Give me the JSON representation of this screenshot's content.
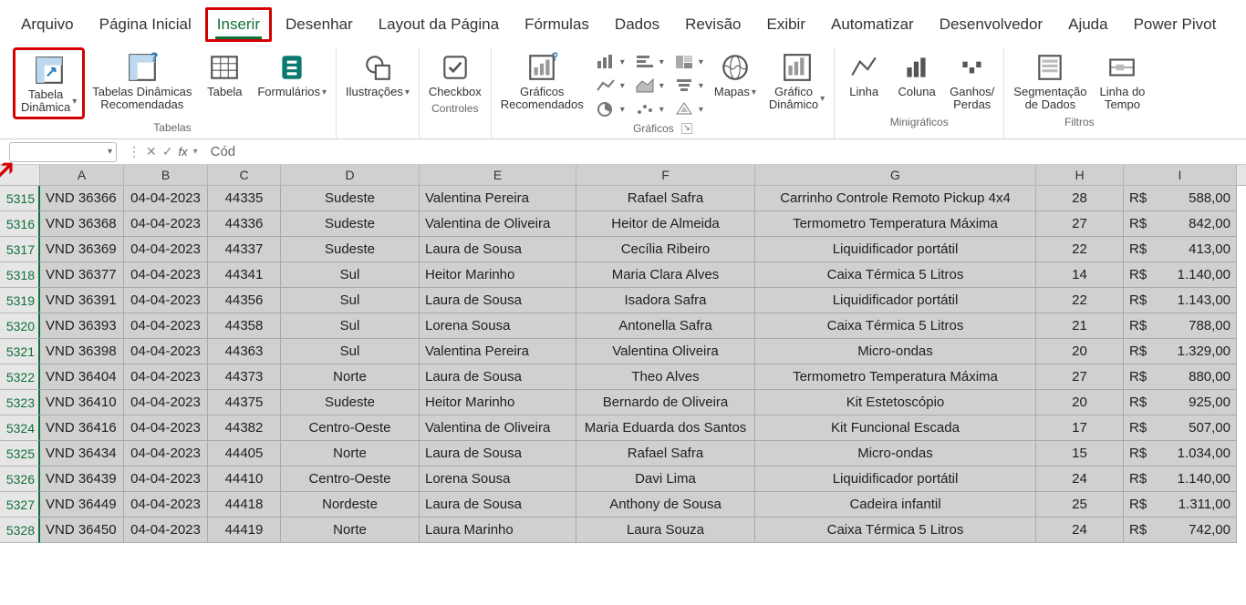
{
  "menu": {
    "tabs": [
      "Arquivo",
      "Página Inicial",
      "Inserir",
      "Desenhar",
      "Layout da Página",
      "Fórmulas",
      "Dados",
      "Revisão",
      "Exibir",
      "Automatizar",
      "Desenvolvedor",
      "Ajuda",
      "Power Pivot"
    ],
    "active_index": 2
  },
  "ribbon": {
    "groups": [
      {
        "name": "Tabelas",
        "items": [
          {
            "label": "Tabela\nDinâmica",
            "caret": true,
            "icon": "pivot-table",
            "highlighted": true
          },
          {
            "label": "Tabelas Dinâmicas\nRecomendadas",
            "icon": "pivot-recommended"
          },
          {
            "label": "Tabela",
            "icon": "table"
          },
          {
            "label": "Formulários",
            "caret": true,
            "icon": "forms"
          }
        ]
      },
      {
        "name": "",
        "items": [
          {
            "label": "Ilustrações",
            "caret": true,
            "icon": "shapes"
          }
        ]
      },
      {
        "name": "Controles",
        "items": [
          {
            "label": "Checkbox",
            "icon": "checkbox"
          }
        ]
      },
      {
        "name": "Gráficos",
        "launcher": true,
        "items": [
          {
            "label": "Gráficos\nRecomendados",
            "icon": "chart-recommended"
          },
          {
            "stack": true,
            "minis": [
              {
                "icon": "chart-bar"
              },
              {
                "icon": "chart-line"
              },
              {
                "icon": "chart-pie"
              }
            ]
          },
          {
            "stack": true,
            "minis": [
              {
                "icon": "chart-hbar"
              },
              {
                "icon": "chart-area"
              },
              {
                "icon": "chart-scatter"
              }
            ]
          },
          {
            "stack": true,
            "minis": [
              {
                "icon": "chart-tree"
              },
              {
                "icon": "chart-funnel"
              },
              {
                "icon": "chart-radar"
              }
            ]
          },
          {
            "label": "Mapas",
            "caret": true,
            "icon": "map"
          },
          {
            "label": "Gráfico\nDinâmico",
            "caret": true,
            "icon": "pivot-chart"
          }
        ]
      },
      {
        "name": "Minigráficos",
        "items": [
          {
            "label": "Linha",
            "icon": "spark-line"
          },
          {
            "label": "Coluna",
            "icon": "spark-col"
          },
          {
            "label": "Ganhos/\nPerdas",
            "icon": "spark-winloss"
          }
        ]
      },
      {
        "name": "Filtros",
        "items": [
          {
            "label": "Segmentação\nde Dados",
            "icon": "slicer"
          },
          {
            "label": "Linha do\nTempo",
            "icon": "timeline"
          }
        ]
      }
    ]
  },
  "formula_bar": {
    "name_box": "",
    "value": "Cód"
  },
  "columns": [
    "A",
    "B",
    "C",
    "D",
    "E",
    "F",
    "G",
    "H",
    "I"
  ],
  "row_start": 5315,
  "rows": [
    {
      "r": 5315,
      "A": "VND 36366",
      "B": "04-04-2023",
      "C": "44335",
      "D": "Sudeste",
      "E": "Valentina Pereira",
      "F": "Rafael Safra",
      "G": "Carrinho Controle Remoto Pickup 4x4",
      "H": "28",
      "I_cur": "R$",
      "I_val": "588,00"
    },
    {
      "r": 5316,
      "A": "VND 36368",
      "B": "04-04-2023",
      "C": "44336",
      "D": "Sudeste",
      "E": "Valentina de Oliveira",
      "F": "Heitor de Almeida",
      "G": "Termometro Temperatura Máxima",
      "H": "27",
      "I_cur": "R$",
      "I_val": "842,00"
    },
    {
      "r": 5317,
      "A": "VND 36369",
      "B": "04-04-2023",
      "C": "44337",
      "D": "Sudeste",
      "E": "Laura de Sousa",
      "F": "Cecília Ribeiro",
      "G": "Liquidificador portátil",
      "H": "22",
      "I_cur": "R$",
      "I_val": "413,00"
    },
    {
      "r": 5318,
      "A": "VND 36377",
      "B": "04-04-2023",
      "C": "44341",
      "D": "Sul",
      "E": "Heitor Marinho",
      "F": "Maria Clara Alves",
      "G": "Caixa Térmica 5 Litros",
      "H": "14",
      "I_cur": "R$",
      "I_val": "1.140,00"
    },
    {
      "r": 5319,
      "A": "VND 36391",
      "B": "04-04-2023",
      "C": "44356",
      "D": "Sul",
      "E": "Laura de Sousa",
      "F": "Isadora Safra",
      "G": "Liquidificador portátil",
      "H": "22",
      "I_cur": "R$",
      "I_val": "1.143,00"
    },
    {
      "r": 5320,
      "A": "VND 36393",
      "B": "04-04-2023",
      "C": "44358",
      "D": "Sul",
      "E": "Lorena Sousa",
      "F": "Antonella Safra",
      "G": "Caixa Térmica 5 Litros",
      "H": "21",
      "I_cur": "R$",
      "I_val": "788,00"
    },
    {
      "r": 5321,
      "A": "VND 36398",
      "B": "04-04-2023",
      "C": "44363",
      "D": "Sul",
      "E": "Valentina Pereira",
      "F": "Valentina Oliveira",
      "G": "Micro-ondas",
      "H": "20",
      "I_cur": "R$",
      "I_val": "1.329,00"
    },
    {
      "r": 5322,
      "A": "VND 36404",
      "B": "04-04-2023",
      "C": "44373",
      "D": "Norte",
      "E": "Laura de Sousa",
      "F": "Theo Alves",
      "G": "Termometro Temperatura Máxima",
      "H": "27",
      "I_cur": "R$",
      "I_val": "880,00"
    },
    {
      "r": 5323,
      "A": "VND 36410",
      "B": "04-04-2023",
      "C": "44375",
      "D": "Sudeste",
      "E": "Heitor Marinho",
      "F": "Bernardo de Oliveira",
      "G": "Kit Estetoscópio",
      "H": "20",
      "I_cur": "R$",
      "I_val": "925,00"
    },
    {
      "r": 5324,
      "A": "VND 36416",
      "B": "04-04-2023",
      "C": "44382",
      "D": "Centro-Oeste",
      "E": "Valentina de Oliveira",
      "F": "Maria Eduarda dos Santos",
      "G": "Kit Funcional Escada",
      "H": "17",
      "I_cur": "R$",
      "I_val": "507,00"
    },
    {
      "r": 5325,
      "A": "VND 36434",
      "B": "04-04-2023",
      "C": "44405",
      "D": "Norte",
      "E": "Laura de Sousa",
      "F": "Rafael Safra",
      "G": "Micro-ondas",
      "H": "15",
      "I_cur": "R$",
      "I_val": "1.034,00"
    },
    {
      "r": 5326,
      "A": "VND 36439",
      "B": "04-04-2023",
      "C": "44410",
      "D": "Centro-Oeste",
      "E": "Lorena Sousa",
      "F": "Davi Lima",
      "G": "Liquidificador portátil",
      "H": "24",
      "I_cur": "R$",
      "I_val": "1.140,00"
    },
    {
      "r": 5327,
      "A": "VND 36449",
      "B": "04-04-2023",
      "C": "44418",
      "D": "Nordeste",
      "E": "Laura de Sousa",
      "F": "Anthony de Sousa",
      "G": "Cadeira infantil",
      "H": "25",
      "I_cur": "R$",
      "I_val": "1.311,00"
    },
    {
      "r": 5328,
      "A": "VND 36450",
      "B": "04-04-2023",
      "C": "44419",
      "D": "Norte",
      "E": "Laura Marinho",
      "F": "Laura Souza",
      "G": "Caixa Térmica 5 Litros",
      "H": "24",
      "I_cur": "R$",
      "I_val": "742,00"
    }
  ]
}
